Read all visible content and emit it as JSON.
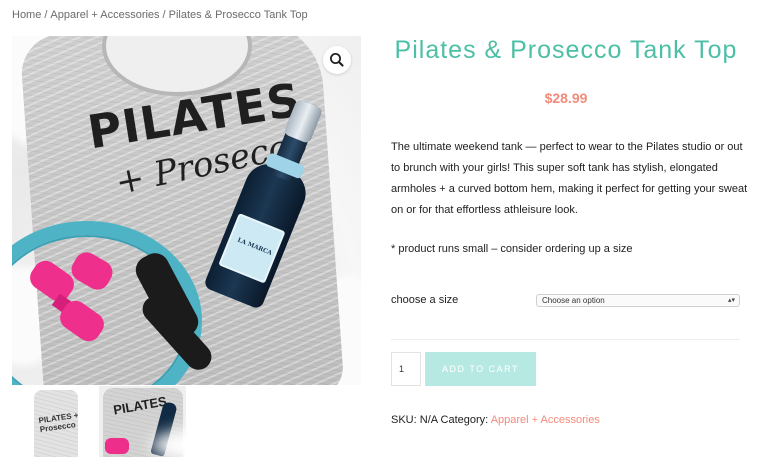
{
  "breadcrumb": {
    "home": "Home",
    "category": "Apparel + Accessories",
    "current": "Pilates & Prosecco Tank Top",
    "separator": "/"
  },
  "gallery": {
    "zoom_icon": "magnifier-icon",
    "print_line1": "PILATES",
    "print_line2": "+ Prosecco",
    "bottle_label": "LA MARCA",
    "thumb1_text": "PILATES + Prosecco",
    "thumb2_text": "PILATES"
  },
  "product": {
    "title": "Pilates & Prosecco Tank Top",
    "price": "$28.99",
    "description": "The ultimate weekend tank — perfect to wear to the Pilates studio or out to brunch with your girls! This super soft tank has stylish, elongated armholes + a curved bottom hem, making it perfect for getting your sweat on or for that effortless athleisure look.",
    "note": "* product runs small – consider ordering up a size"
  },
  "variation": {
    "label": "choose a size",
    "selected": "Choose an option"
  },
  "cart": {
    "quantity": "1",
    "add_label": "ADD TO CART"
  },
  "meta": {
    "sku_label": "SKU:",
    "sku_value": "N/A",
    "category_label": "Category:",
    "category_value": "Apparel + Accessories"
  },
  "colors": {
    "title": "#4cbfa6",
    "price": "#f28b7b",
    "button": "#b7e9e3",
    "link": "#f28b7b"
  }
}
